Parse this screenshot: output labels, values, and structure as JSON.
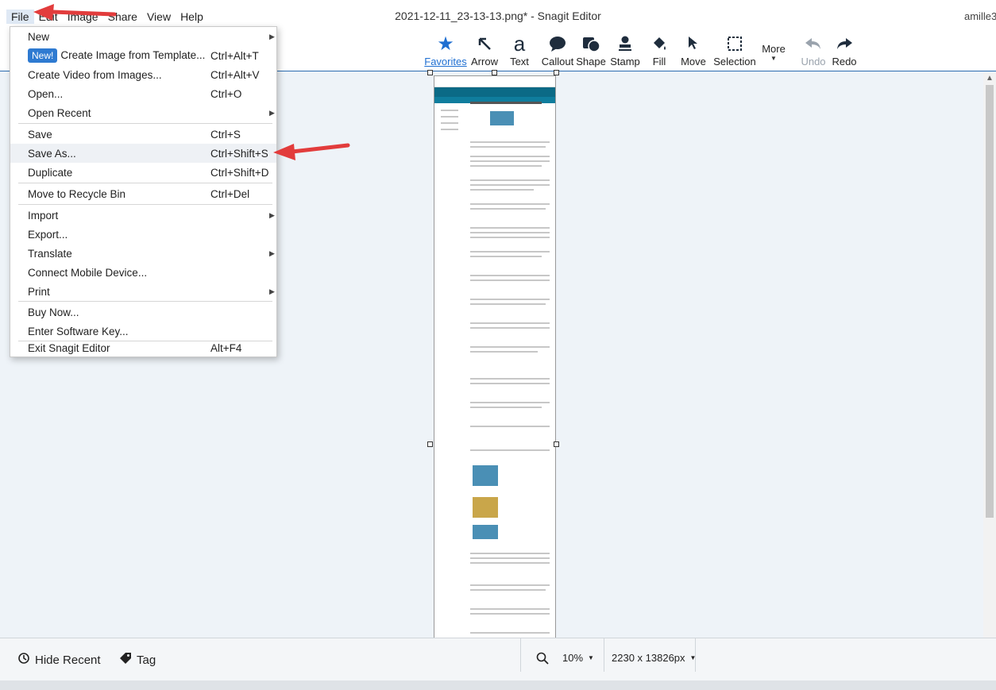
{
  "menubar": {
    "items": [
      "File",
      "Edit",
      "Image",
      "Share",
      "View",
      "Help"
    ]
  },
  "window": {
    "title": "2021-12-11_23-13-13.png* - Snagit Editor",
    "user": "amille3"
  },
  "toolbar": {
    "tools": [
      {
        "label": "Favorites",
        "icon": "star-icon",
        "active": true
      },
      {
        "label": "Arrow",
        "icon": "arrow-icon"
      },
      {
        "label": "Text",
        "icon": "text-icon"
      },
      {
        "label": "Callout",
        "icon": "callout-icon"
      },
      {
        "label": "Shape",
        "icon": "shape-icon"
      },
      {
        "label": "Stamp",
        "icon": "stamp-icon"
      },
      {
        "label": "Fill",
        "icon": "fill-icon"
      },
      {
        "label": "Move",
        "icon": "move-icon"
      },
      {
        "label": "Selection",
        "icon": "selection-icon"
      }
    ],
    "more_label": "More",
    "undo_label": "Undo",
    "redo_label": "Redo"
  },
  "file_menu": {
    "new": "New",
    "new_badge": "New!",
    "create_template": "Create Image from Template...",
    "create_template_shortcut": "Ctrl+Alt+T",
    "create_video": "Create Video from Images...",
    "create_video_shortcut": "Ctrl+Alt+V",
    "open": "Open...",
    "open_shortcut": "Ctrl+O",
    "open_recent": "Open Recent",
    "save": "Save",
    "save_shortcut": "Ctrl+S",
    "save_as": "Save As...",
    "save_as_shortcut": "Ctrl+Shift+S",
    "duplicate": "Duplicate",
    "duplicate_shortcut": "Ctrl+Shift+D",
    "recycle": "Move to Recycle Bin",
    "recycle_shortcut": "Ctrl+Del",
    "import": "Import",
    "export": "Export...",
    "translate": "Translate",
    "connect_mobile": "Connect Mobile Device...",
    "print": "Print",
    "buy_now": "Buy Now...",
    "enter_key": "Enter Software Key...",
    "exit": "Exit Snagit Editor",
    "exit_shortcut": "Alt+F4"
  },
  "bottombar": {
    "hide_recent": "Hide Recent",
    "tag": "Tag",
    "zoom": "10%",
    "dimensions": "2230 x 13826px"
  }
}
